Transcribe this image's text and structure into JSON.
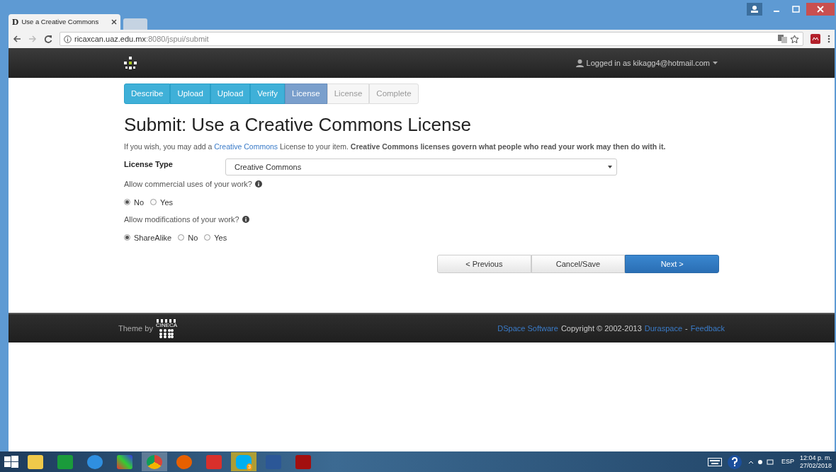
{
  "browser": {
    "favicon": "D",
    "tab_title": "Use a Creative Commons",
    "url_host": "ricaxcan.uaz.edu.mx",
    "url_path": ":8080/jspui/submit"
  },
  "navbar": {
    "user": "Logged in as kikagg4@hotmail.com"
  },
  "steps": [
    {
      "label": "Describe",
      "completed": true,
      "selected": false
    },
    {
      "label": "Upload",
      "completed": true,
      "selected": false
    },
    {
      "label": "Upload",
      "completed": true,
      "selected": false
    },
    {
      "label": "Verify",
      "completed": true,
      "selected": false
    },
    {
      "label": "License",
      "completed": false,
      "selected": true
    },
    {
      "label": "License",
      "completed": false,
      "selected": false
    },
    {
      "label": "Complete",
      "completed": false,
      "selected": false
    }
  ],
  "heading": "Submit: Use a Creative Commons License",
  "intro": {
    "before": "If you wish, you may add a ",
    "link": "Creative Commons",
    "after": " License to your item. **Creative Commons licenses govern what people who read your work may then do with it.**"
  },
  "license_type": {
    "label": "License Type",
    "value": "Creative Commons"
  },
  "questions": [
    {
      "label": "Allow commercial uses of your work?",
      "options": [
        {
          "label": "No",
          "selected": true
        },
        {
          "label": "Yes",
          "selected": false
        }
      ]
    },
    {
      "label": "Allow modifications of your work?",
      "options": [
        {
          "label": "ShareAlike",
          "selected": true
        },
        {
          "label": "No",
          "selected": false
        },
        {
          "label": "Yes",
          "selected": false
        }
      ]
    }
  ],
  "buttons": [
    {
      "label": "< Previous",
      "kind": "default"
    },
    {
      "label": "Cancel/Save",
      "kind": "default"
    },
    {
      "label": "Next >",
      "kind": "primary"
    }
  ],
  "footer": {
    "theme_by": "Theme by",
    "logo_text": "CINECA",
    "links": [
      {
        "text": "DSpace Software",
        "kind": "link"
      },
      {
        "text": "Copyright © 2002-2013",
        "kind": "text"
      },
      {
        "text": "Duraspace",
        "kind": "link"
      },
      {
        "text": "-",
        "kind": "text"
      },
      {
        "text": "Feedback",
        "kind": "link"
      }
    ]
  },
  "taskbar": {
    "skype_badge": "3",
    "language": "ESP",
    "time": "12:04 p. m.",
    "date": "27/02/2018"
  }
}
